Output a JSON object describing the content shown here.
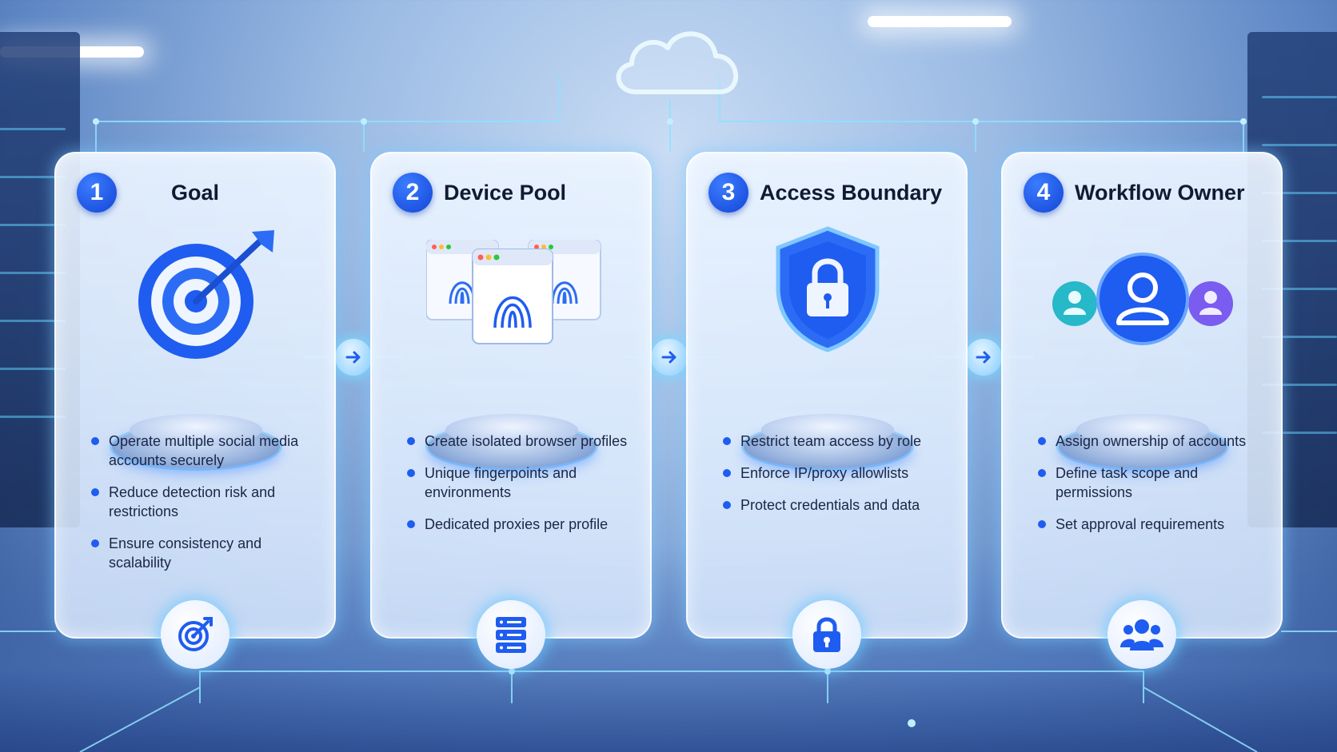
{
  "steps": [
    {
      "number": "1",
      "title": "Goal",
      "illustration": "target-with-arrow",
      "bullets": [
        "Operate multiple social media accounts securely",
        "Reduce detection risk and restrictions",
        "Ensure consistency and scalability"
      ],
      "bottom_icon": "target-icon"
    },
    {
      "number": "2",
      "title": "Device Pool",
      "illustration": "browser-windows-with-fingerprints",
      "bullets": [
        "Create isolated browser profiles",
        "Unique fingerpoints and environments",
        "Dedicated proxies per profile"
      ],
      "bottom_icon": "server-icon"
    },
    {
      "number": "3",
      "title": "Access Boundary",
      "illustration": "shield-with-lock",
      "bullets": [
        "Restrict team access by role",
        "Enforce IP/proxy allowlists",
        "Protect credentials and data"
      ],
      "bottom_icon": "lock-icon"
    },
    {
      "number": "4",
      "title": "Workflow Owner",
      "illustration": "user-avatars",
      "bullets": [
        "Assign ownership of accounts",
        "Define task scope and permissions",
        "Set approval requirements"
      ],
      "bottom_icon": "team-icon"
    }
  ],
  "connector_icon": "arrow-right-icon",
  "top_icon": "cloud-icon",
  "colors": {
    "accent": "#1f5cf0",
    "glow": "#7fd8ff",
    "text": "#101a33"
  }
}
